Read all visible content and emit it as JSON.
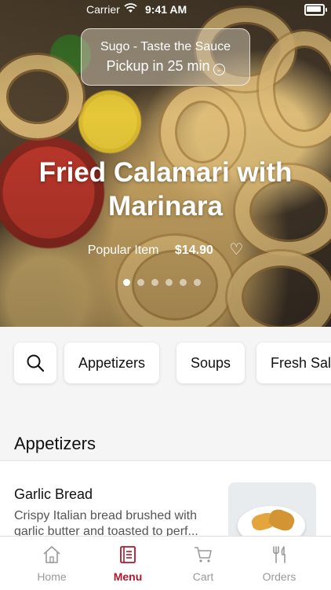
{
  "status_bar": {
    "carrier": "Carrier",
    "time": "9:41 AM"
  },
  "pickup": {
    "restaurant": "Sugo - Taste the Sauce",
    "pickup_text": "Pickup in 25 min"
  },
  "hero": {
    "title": "Fried Calamari with Marinara",
    "tag": "Popular Item",
    "price": "$14.90",
    "carousel_total": 6,
    "carousel_active": 1
  },
  "categories": [
    "Appetizers",
    "Soups",
    "Fresh Sal"
  ],
  "section": {
    "title": "Appetizers"
  },
  "menu_items": [
    {
      "name": "Garlic Bread",
      "description": "Crispy Italian bread brushed with garlic butter and toasted to perf..."
    }
  ],
  "tabs": [
    {
      "label": "Home",
      "icon": "home-icon"
    },
    {
      "label": "Menu",
      "icon": "menu-icon",
      "active": true
    },
    {
      "label": "Cart",
      "icon": "cart-icon"
    },
    {
      "label": "Orders",
      "icon": "orders-icon"
    }
  ],
  "colors": {
    "accent": "#b3162a",
    "inactive": "#9a9a9a"
  }
}
